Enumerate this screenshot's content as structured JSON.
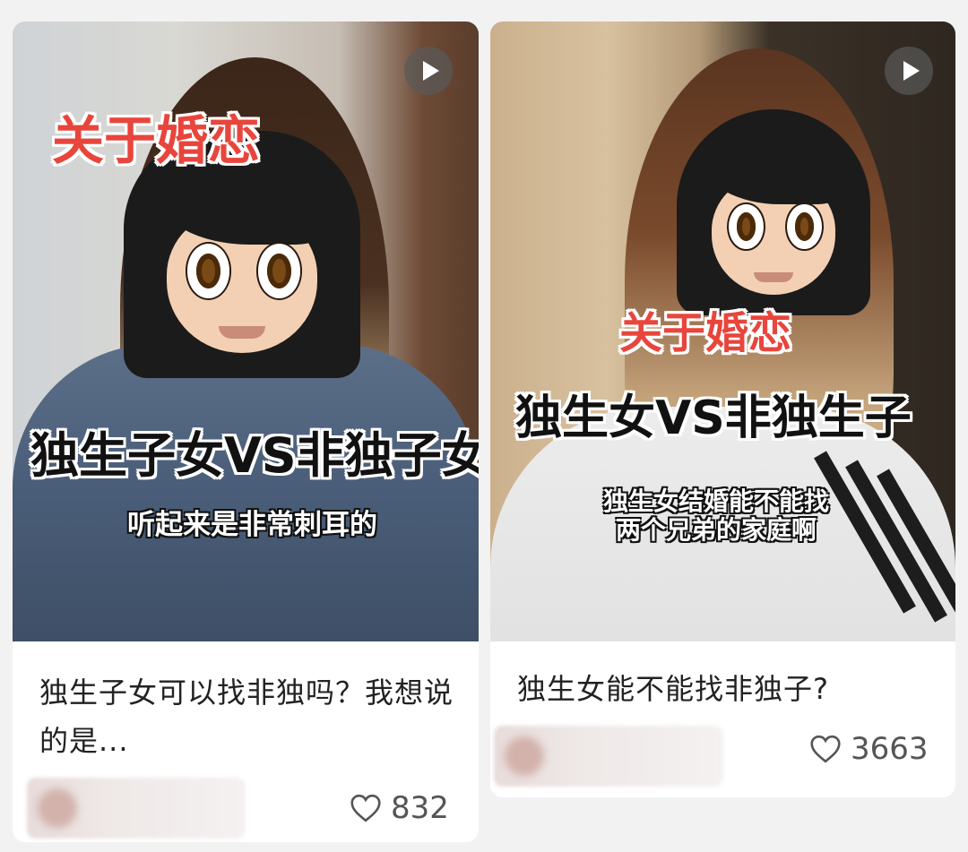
{
  "feed": {
    "cards": [
      {
        "overlay_tag": "关于婚恋",
        "overlay_title": "独生子女VS非独子女",
        "overlay_subtitle": "听起来是非常刺耳的",
        "title": "独生子女可以找非独吗？我想说的是...",
        "likes": "832",
        "is_video": true
      },
      {
        "overlay_tag": "关于婚恋",
        "overlay_title": "独生女VS非独生子",
        "overlay_subtitle": "独生女结婚能不能找\n两个兄弟的家庭啊",
        "title": "独生女能不能找非独子?",
        "likes": "3663",
        "is_video": true
      }
    ]
  }
}
